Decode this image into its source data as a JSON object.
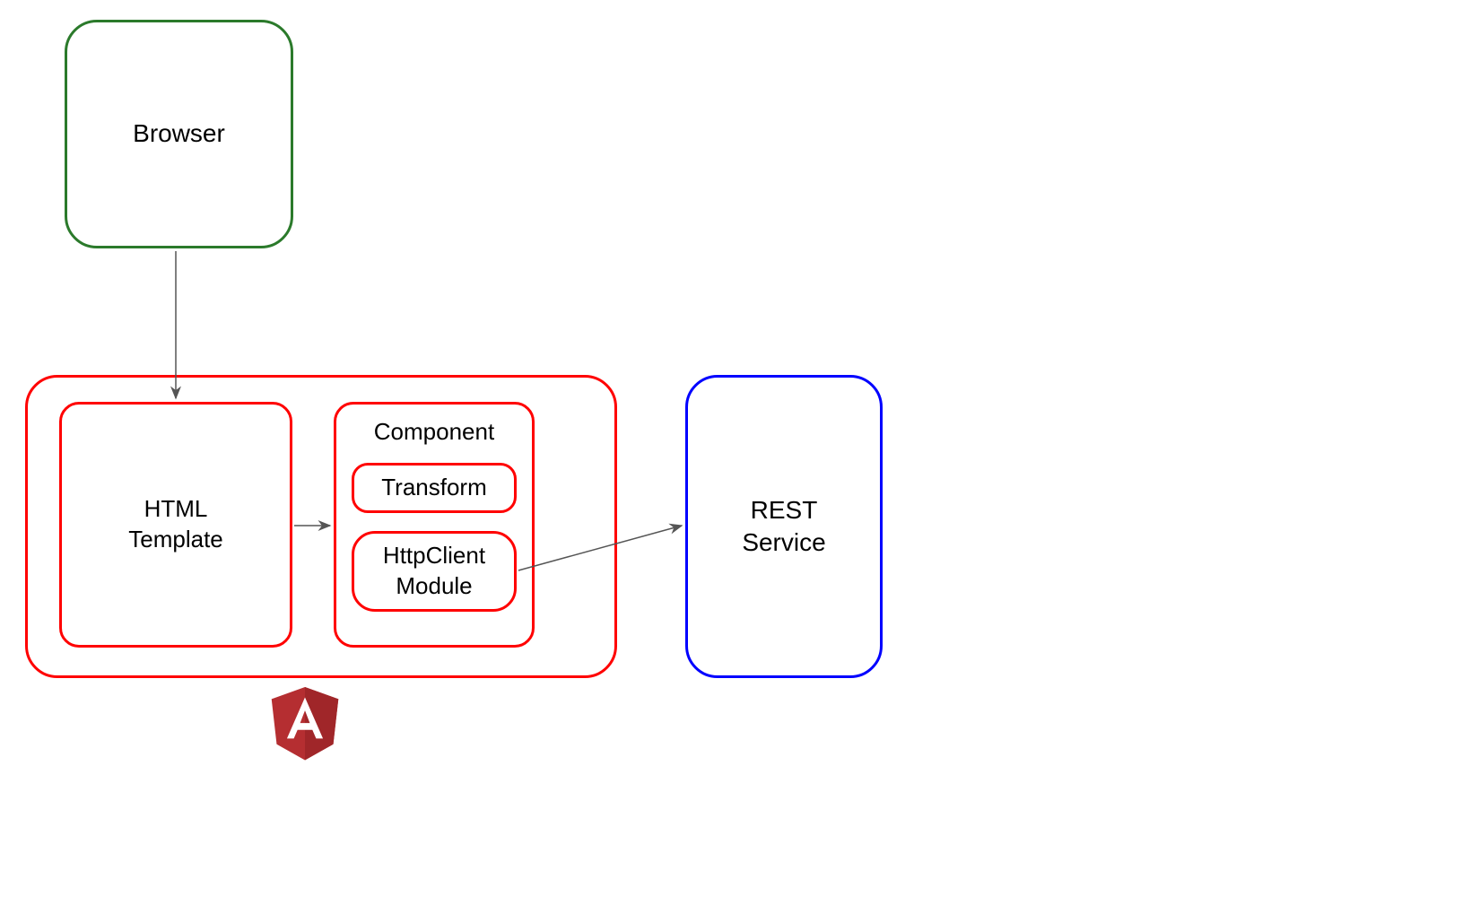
{
  "nodes": {
    "browser": {
      "label": "Browser",
      "stroke": "#2b7a2b"
    },
    "angular_container": {
      "stroke": "#ff0000"
    },
    "html_template": {
      "label": "HTML\nTemplate",
      "stroke": "#ff0000"
    },
    "component": {
      "label": "Component",
      "stroke": "#ff0000"
    },
    "transform": {
      "label": "Transform",
      "stroke": "#ff0000"
    },
    "httpclient": {
      "label": "HttpClient\nModule",
      "stroke": "#ff0000"
    },
    "rest_service": {
      "label": "REST\nService",
      "stroke": "#0000ff"
    }
  },
  "logo": {
    "name": "angular",
    "letter": "A",
    "fill": "#b52e31"
  },
  "edges": [
    {
      "from": "browser",
      "to": "html_template"
    },
    {
      "from": "html_template",
      "to": "component"
    },
    {
      "from": "httpclient",
      "to": "rest_service"
    }
  ]
}
